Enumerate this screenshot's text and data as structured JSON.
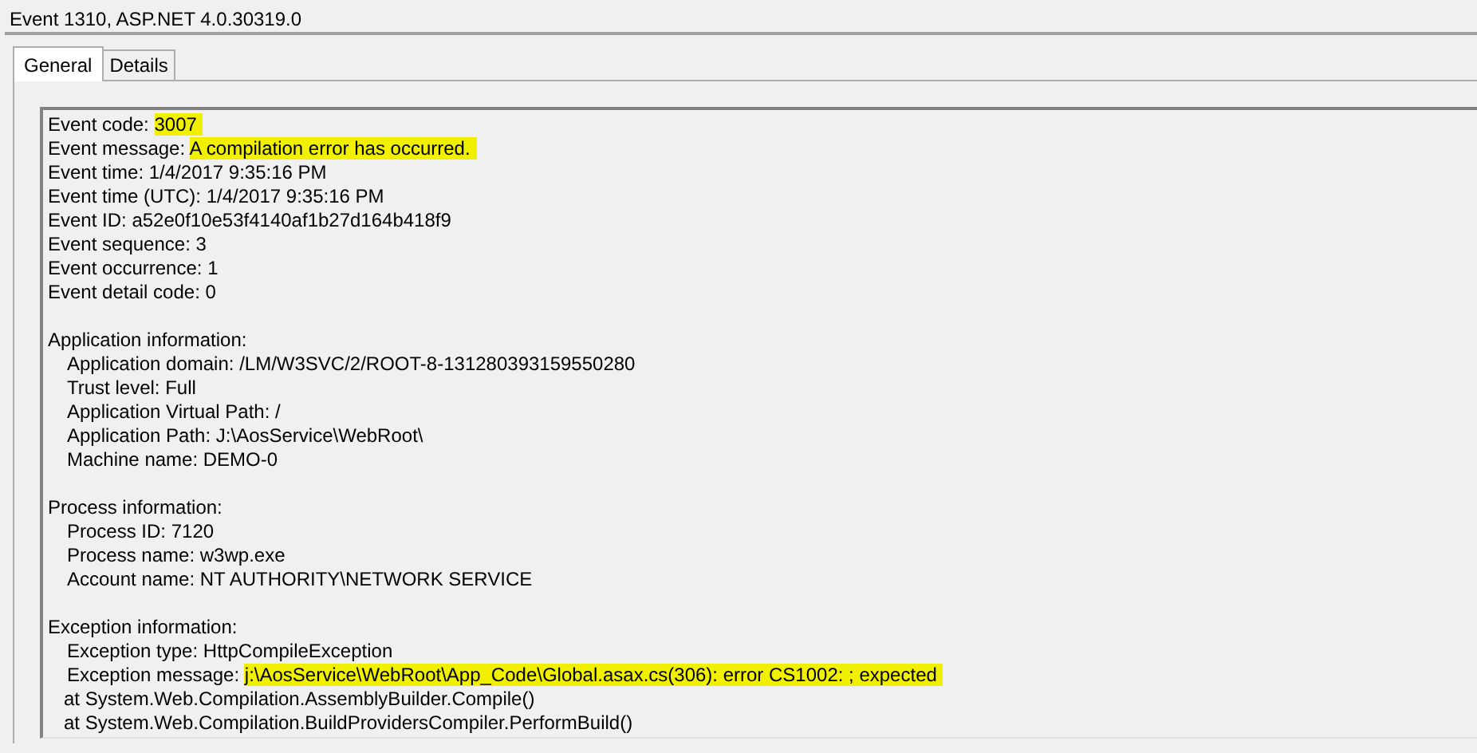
{
  "window": {
    "title": "Event 1310, ASP.NET 4.0.30319.0"
  },
  "tabs": [
    {
      "label": "General",
      "selected": true
    },
    {
      "label": "Details",
      "selected": false
    }
  ],
  "sections": [
    {
      "lines": [
        {
          "kind": "field",
          "label": "Event code:",
          "value": "3007",
          "highlighted": true
        },
        {
          "kind": "field",
          "label": "Event message:",
          "value": "A compilation error has occurred.",
          "highlighted": true
        },
        {
          "kind": "field",
          "label": "Event time:",
          "value": "1/4/2017 9:35:16 PM",
          "highlighted": false
        },
        {
          "kind": "field",
          "label": "Event time (UTC):",
          "value": "1/4/2017 9:35:16 PM",
          "highlighted": false
        },
        {
          "kind": "field",
          "label": "Event ID:",
          "value": "a52e0f10e53f4140af1b27d164b418f9",
          "highlighted": false
        },
        {
          "kind": "field",
          "label": "Event sequence:",
          "value": "3",
          "highlighted": false
        },
        {
          "kind": "field",
          "label": "Event occurrence:",
          "value": "1",
          "highlighted": false
        },
        {
          "kind": "field",
          "label": "Event detail code:",
          "value": "0",
          "highlighted": false
        }
      ]
    },
    {
      "heading": "Application information:",
      "lines": [
        {
          "kind": "field",
          "label": "Application domain:",
          "value": "/LM/W3SVC/2/ROOT-8-131280393159550280",
          "highlighted": false
        },
        {
          "kind": "field",
          "label": "Trust level:",
          "value": "Full",
          "highlighted": false
        },
        {
          "kind": "field",
          "label": "Application Virtual Path:",
          "value": "/",
          "highlighted": false
        },
        {
          "kind": "field",
          "label": "Application Path:",
          "value": "J:\\AosService\\WebRoot\\",
          "highlighted": false
        },
        {
          "kind": "field",
          "label": "Machine name:",
          "value": "DEMO-0",
          "highlighted": false
        }
      ]
    },
    {
      "heading": "Process information:",
      "lines": [
        {
          "kind": "field",
          "label": "Process ID:",
          "value": "7120",
          "highlighted": false
        },
        {
          "kind": "field",
          "label": "Process name:",
          "value": "w3wp.exe",
          "highlighted": false
        },
        {
          "kind": "field",
          "label": "Account name:",
          "value": "NT AUTHORITY\\NETWORK SERVICE",
          "highlighted": false
        }
      ]
    },
    {
      "heading": "Exception information:",
      "lines": [
        {
          "kind": "field",
          "label": "Exception type:",
          "value": "HttpCompileException",
          "highlighted": false
        },
        {
          "kind": "field",
          "label": "Exception message:",
          "value": "j:\\AosService\\WebRoot\\App_Code\\Global.asax.cs(306): error CS1002: ; expected",
          "highlighted": true
        },
        {
          "kind": "stack",
          "label": "at System.Web.Compilation.AssemblyBuilder.Compile()"
        },
        {
          "kind": "stack",
          "label": "at System.Web.Compilation.BuildProvidersCompiler.PerformBuild()"
        }
      ]
    }
  ]
}
